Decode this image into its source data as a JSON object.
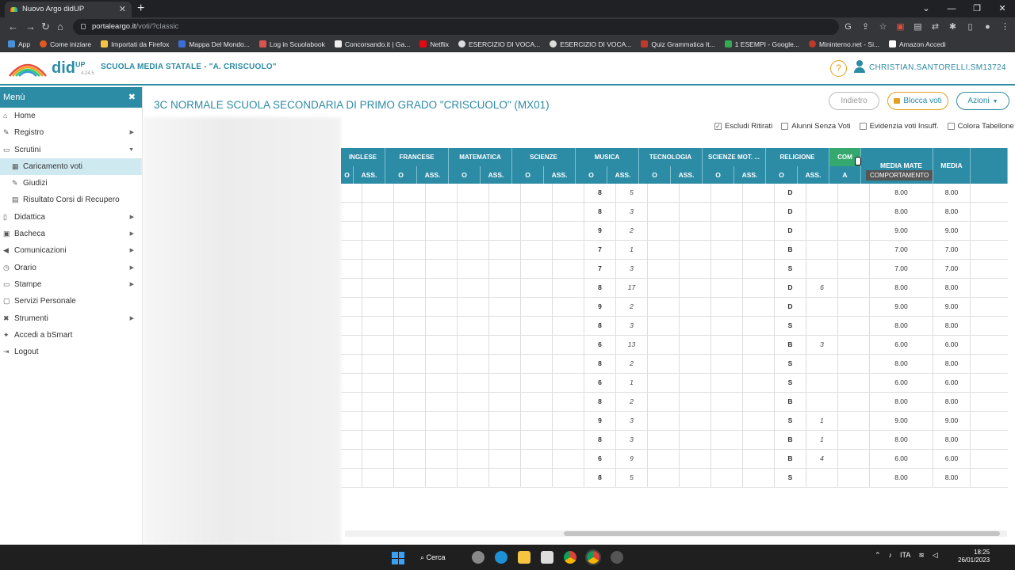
{
  "browser": {
    "tab_title": "Nuovo Argo didUP",
    "url_host": "portaleargo.it",
    "url_path": "/voti/?classic",
    "bookmarks": [
      "App",
      "Come iniziare",
      "Importati da Firefox",
      "Mappa Del Mondo...",
      "Log in Scuolabook",
      "Concorsando.it | Ga...",
      "Netflix",
      "ESERCIZIO DI VOCA...",
      "ESERCIZIO DI VOCA...",
      "Quiz Grammatica It...",
      "1 ESEMPI - Google...",
      "Mininterno.net - Si...",
      "Amazon Accedi"
    ]
  },
  "app": {
    "brand": "did",
    "brand_sup": "UP",
    "version": "4.24.5",
    "school": "SCUOLA MEDIA STATALE - \"A. CRISCUOLO\"",
    "help": "?",
    "user": "CHRISTIAN.SANTORELLI.SM13724"
  },
  "sidebar": {
    "title": "Menù",
    "items": [
      {
        "label": "Home"
      },
      {
        "label": "Registro"
      },
      {
        "label": "Scrutini"
      },
      {
        "label": "Caricamento voti"
      },
      {
        "label": "Giudizi"
      },
      {
        "label": "Risultato Corsi di Recupero"
      },
      {
        "label": "Didattica"
      },
      {
        "label": "Bacheca"
      },
      {
        "label": "Comunicazioni"
      },
      {
        "label": "Orario"
      },
      {
        "label": "Stampe"
      },
      {
        "label": "Servizi Personale"
      },
      {
        "label": "Strumenti"
      },
      {
        "label": "Accedi a bSmart"
      },
      {
        "label": "Logout"
      }
    ]
  },
  "main": {
    "title": "3C NORMALE SCUOLA SECONDARIA DI PRIMO GRADO \"CRISCUOLO\" (MX01)",
    "buttons": {
      "back": "Indietro",
      "lock": "Blocca voti",
      "actions": "Azioni"
    },
    "filters": [
      {
        "label": "Escludi Ritirati",
        "checked": true
      },
      {
        "label": "Alunni Senza Voti",
        "checked": false
      },
      {
        "label": "Evidenzia voti Insuff.",
        "checked": false
      },
      {
        "label": "Colora Tabellone",
        "checked": false
      }
    ],
    "subjects": [
      "INGLESE",
      "FRANCESE",
      "MATEMATICA",
      "SCIENZE",
      "MUSICA",
      "TECNOLOGIA",
      "SCIENZE MOT. ...",
      "RELIGIONE"
    ],
    "behaviour_short": "COM",
    "col_o": "O",
    "col_ass": "ASS.",
    "col_a": "A",
    "media_mate": "MEDIA MATE",
    "media": "MEDIA",
    "tooltip": "COMPORTAMENTO",
    "rows": [
      {
        "musica_o": "8",
        "musica_ass": "5",
        "rel_o": "D",
        "rel_ass": "",
        "media_mate": "8.00",
        "media": "8.00"
      },
      {
        "musica_o": "8",
        "musica_ass": "3",
        "rel_o": "D",
        "rel_ass": "",
        "media_mate": "8.00",
        "media": "8.00"
      },
      {
        "musica_o": "9",
        "musica_ass": "2",
        "rel_o": "D",
        "rel_ass": "",
        "media_mate": "9.00",
        "media": "9.00"
      },
      {
        "musica_o": "7",
        "musica_ass": "1",
        "rel_o": "B",
        "rel_ass": "",
        "media_mate": "7.00",
        "media": "7.00"
      },
      {
        "musica_o": "7",
        "musica_ass": "3",
        "rel_o": "S",
        "rel_ass": "",
        "media_mate": "7.00",
        "media": "7.00"
      },
      {
        "musica_o": "8",
        "musica_ass": "17",
        "rel_o": "D",
        "rel_ass": "6",
        "media_mate": "8.00",
        "media": "8.00"
      },
      {
        "musica_o": "9",
        "musica_ass": "2",
        "rel_o": "D",
        "rel_ass": "",
        "media_mate": "9.00",
        "media": "9.00"
      },
      {
        "musica_o": "8",
        "musica_ass": "3",
        "rel_o": "S",
        "rel_ass": "",
        "media_mate": "8.00",
        "media": "8.00"
      },
      {
        "musica_o": "6",
        "musica_ass": "13",
        "rel_o": "B",
        "rel_ass": "3",
        "media_mate": "6.00",
        "media": "6.00"
      },
      {
        "musica_o": "8",
        "musica_ass": "2",
        "rel_o": "S",
        "rel_ass": "",
        "media_mate": "8.00",
        "media": "8.00"
      },
      {
        "musica_o": "6",
        "musica_ass": "1",
        "rel_o": "S",
        "rel_ass": "",
        "media_mate": "6.00",
        "media": "6.00"
      },
      {
        "musica_o": "8",
        "musica_ass": "2",
        "rel_o": "B",
        "rel_ass": "",
        "media_mate": "8.00",
        "media": "8.00"
      },
      {
        "musica_o": "9",
        "musica_ass": "3",
        "rel_o": "S",
        "rel_ass": "1",
        "media_mate": "9.00",
        "media": "9.00"
      },
      {
        "musica_o": "8",
        "musica_ass": "3",
        "rel_o": "B",
        "rel_ass": "1",
        "media_mate": "8.00",
        "media": "8.00"
      },
      {
        "musica_o": "6",
        "musica_ass": "9",
        "rel_o": "B",
        "rel_ass": "4",
        "media_mate": "6.00",
        "media": "6.00"
      },
      {
        "musica_o": "8",
        "musica_ass": "5",
        "rel_o": "S",
        "rel_ass": "",
        "media_mate": "8.00",
        "media": "8.00"
      }
    ]
  },
  "taskbar": {
    "search": "Cerca",
    "lang": "ITA",
    "time": "18:25",
    "date": "26/01/2023"
  }
}
